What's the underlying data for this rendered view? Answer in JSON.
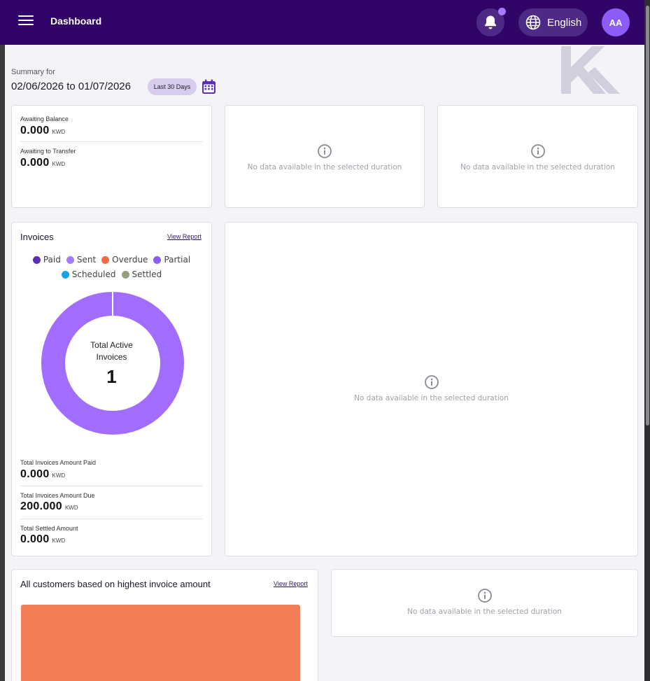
{
  "header": {
    "title": "Dashboard",
    "language": "English",
    "avatar_initials": "AA",
    "colors": {
      "bar_bg": "#300567",
      "pill_bg": "#4d2a86",
      "avatar": "#8b5cf6",
      "notification_dot": "#a47cff"
    }
  },
  "summary": {
    "label": "Summary for",
    "range": "02/06/2026 to 01/07/2026",
    "range_chip": "Last 30 Days"
  },
  "balances": {
    "items": [
      {
        "label": "Awaiting Balance",
        "value": "0.000",
        "unit": "KWD"
      },
      {
        "label": "Awaiting to Transfer",
        "value": "0.000",
        "unit": "KWD"
      }
    ]
  },
  "empty_state": {
    "message": "No data available in the selected duration"
  },
  "invoices": {
    "title": "Invoices",
    "view_report": "View Report",
    "legend": [
      {
        "label": "Paid",
        "color": "#5b2db8"
      },
      {
        "label": "Sent",
        "color": "#a47cff"
      },
      {
        "label": "Overdue",
        "color": "#f06a45"
      },
      {
        "label": "Partial",
        "color": "#8b5cf6"
      },
      {
        "label": "Scheduled",
        "color": "#16a2e6"
      },
      {
        "label": "Settled",
        "color": "#94a07a"
      }
    ],
    "center_label": "Total Active Invoices",
    "total_active": "1",
    "donut_color": "#a06dff",
    "totals": [
      {
        "label": "Total Invoices Amount Paid",
        "value": "0.000",
        "unit": "KWD"
      },
      {
        "label": "Total Invoices Amount Due",
        "value": "200.000",
        "unit": "KWD"
      },
      {
        "label": "Total Settled Amount",
        "value": "0.000",
        "unit": "KWD"
      }
    ]
  },
  "customers": {
    "title": "All customers based on highest invoice amount",
    "view_report": "View Report",
    "bar_color": "#f27e56"
  }
}
